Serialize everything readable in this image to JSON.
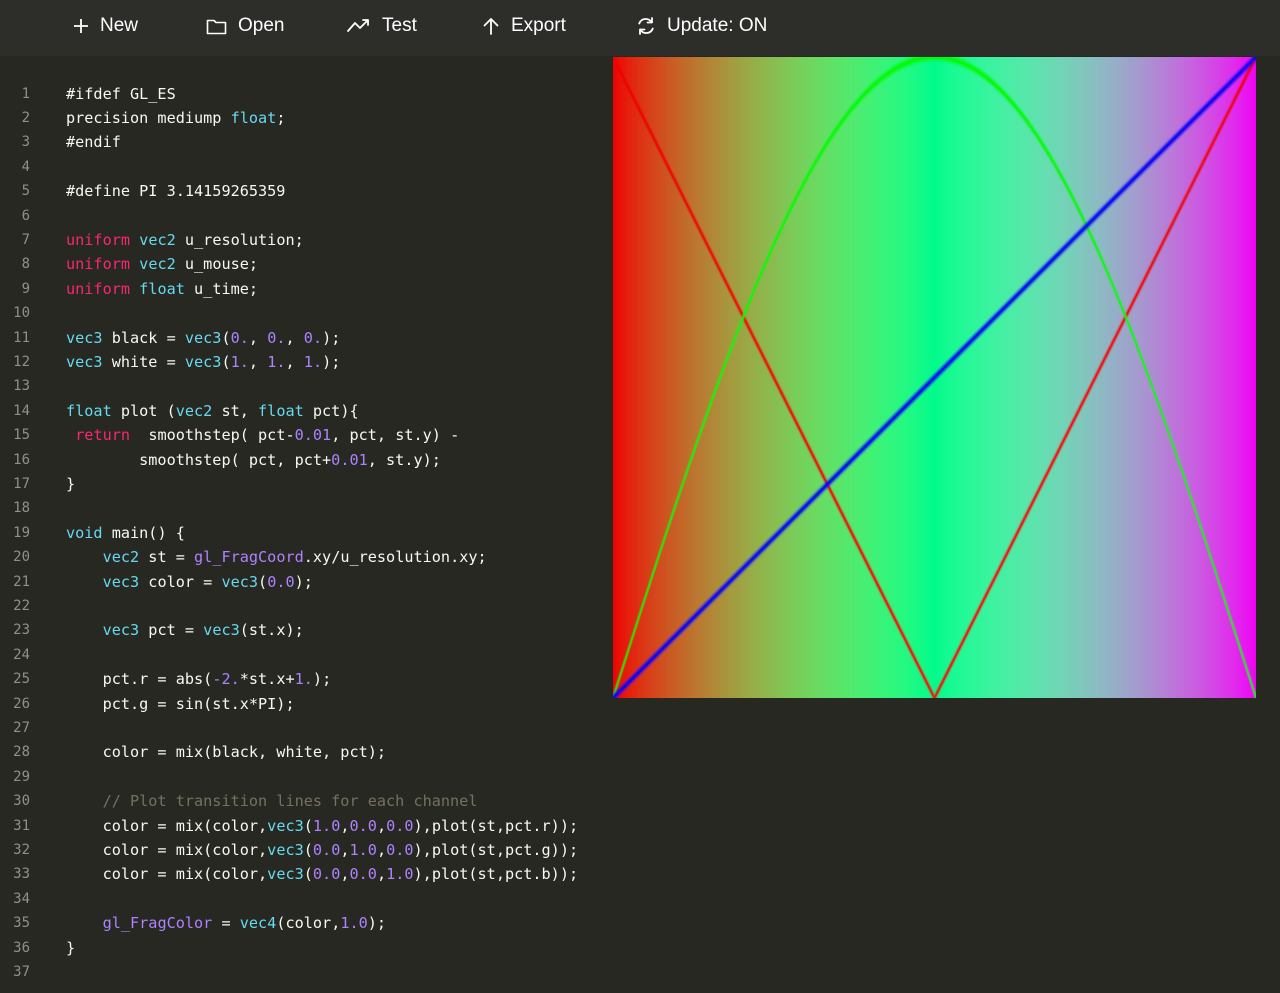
{
  "toolbar": {
    "new_label": "New",
    "open_label": "Open",
    "test_label": "Test",
    "export_label": "Export",
    "update_label": "Update: ON"
  },
  "colors": {
    "background": "#272822",
    "toolbar": "#2d2e2a",
    "keyword": "#f92672",
    "type": "#66d9ef",
    "number": "#ae81ff",
    "comment": "#75715e",
    "text": "#f8f8f2"
  },
  "code": [
    [
      [
        "",
        "#ifdef GL_ES"
      ]
    ],
    [
      [
        "",
        "precision mediump "
      ],
      [
        "ty",
        "float"
      ],
      [
        "",
        ";"
      ]
    ],
    [
      [
        "",
        "#endif"
      ]
    ],
    [],
    [
      [
        "",
        "#define PI 3.14159265359"
      ]
    ],
    [],
    [
      [
        "kw",
        "uniform"
      ],
      [
        "",
        " "
      ],
      [
        "ty",
        "vec2"
      ],
      [
        "",
        " u_resolution;"
      ]
    ],
    [
      [
        "kw",
        "uniform"
      ],
      [
        "",
        " "
      ],
      [
        "ty",
        "vec2"
      ],
      [
        "",
        " u_mouse;"
      ]
    ],
    [
      [
        "kw",
        "uniform"
      ],
      [
        "",
        " "
      ],
      [
        "ty",
        "float"
      ],
      [
        "",
        " u_time;"
      ]
    ],
    [],
    [
      [
        "ty",
        "vec3"
      ],
      [
        "",
        " black = "
      ],
      [
        "ty",
        "vec3"
      ],
      [
        "",
        "("
      ],
      [
        "nm",
        "0."
      ],
      [
        "",
        ", "
      ],
      [
        "nm",
        "0."
      ],
      [
        "",
        ", "
      ],
      [
        "nm",
        "0."
      ],
      [
        "",
        ");"
      ]
    ],
    [
      [
        "ty",
        "vec3"
      ],
      [
        "",
        " white = "
      ],
      [
        "ty",
        "vec3"
      ],
      [
        "",
        "("
      ],
      [
        "nm",
        "1."
      ],
      [
        "",
        ", "
      ],
      [
        "nm",
        "1."
      ],
      [
        "",
        ", "
      ],
      [
        "nm",
        "1."
      ],
      [
        "",
        ");"
      ]
    ],
    [],
    [
      [
        "ty",
        "float"
      ],
      [
        "",
        " plot ("
      ],
      [
        "ty",
        "vec2"
      ],
      [
        "",
        " st, "
      ],
      [
        "ty",
        "float"
      ],
      [
        "",
        " pct){"
      ]
    ],
    [
      [
        "",
        " "
      ],
      [
        "kw",
        "return"
      ],
      [
        "",
        "  smoothstep( pct-"
      ],
      [
        "nm",
        "0.01"
      ],
      [
        "",
        ", pct, st.y) -"
      ]
    ],
    [
      [
        "",
        "        smoothstep( pct, pct+"
      ],
      [
        "nm",
        "0.01"
      ],
      [
        "",
        ", st.y);"
      ]
    ],
    [
      [
        "",
        "}"
      ]
    ],
    [],
    [
      [
        "ty",
        "void"
      ],
      [
        "",
        " main() {"
      ]
    ],
    [
      [
        "",
        "    "
      ],
      [
        "ty",
        "vec2"
      ],
      [
        "",
        " st = "
      ],
      [
        "bi",
        "gl_FragCoord"
      ],
      [
        "",
        ".xy/u_resolution.xy;"
      ]
    ],
    [
      [
        "",
        "    "
      ],
      [
        "ty",
        "vec3"
      ],
      [
        "",
        " color = "
      ],
      [
        "ty",
        "vec3"
      ],
      [
        "",
        "("
      ],
      [
        "nm",
        "0.0"
      ],
      [
        "",
        ");"
      ]
    ],
    [],
    [
      [
        "",
        "    "
      ],
      [
        "ty",
        "vec3"
      ],
      [
        "",
        " pct = "
      ],
      [
        "ty",
        "vec3"
      ],
      [
        "",
        "(st.x);"
      ]
    ],
    [],
    [
      [
        "",
        "    pct.r = abs("
      ],
      [
        "nm",
        "-2."
      ],
      [
        "",
        "*st.x+"
      ],
      [
        "nm",
        "1."
      ],
      [
        "",
        ");"
      ]
    ],
    [
      [
        "",
        "    pct.g = sin(st.x*PI);"
      ]
    ],
    [],
    [
      [
        "",
        "    color = mix(black, white, pct);"
      ]
    ],
    [],
    [
      [
        "cm",
        "    // Plot transition lines for each channel"
      ]
    ],
    [
      [
        "",
        "    color = mix(color,"
      ],
      [
        "ty",
        "vec3"
      ],
      [
        "",
        "("
      ],
      [
        "nm",
        "1.0"
      ],
      [
        "",
        ","
      ],
      [
        "nm",
        "0.0"
      ],
      [
        "",
        ","
      ],
      [
        "nm",
        "0.0"
      ],
      [
        "",
        "),plot(st,pct.r));"
      ]
    ],
    [
      [
        "",
        "    color = mix(color,"
      ],
      [
        "ty",
        "vec3"
      ],
      [
        "",
        "("
      ],
      [
        "nm",
        "0.0"
      ],
      [
        "",
        ","
      ],
      [
        "nm",
        "1.0"
      ],
      [
        "",
        ","
      ],
      [
        "nm",
        "0.0"
      ],
      [
        "",
        "),plot(st,pct.g));"
      ]
    ],
    [
      [
        "",
        "    color = mix(color,"
      ],
      [
        "ty",
        "vec3"
      ],
      [
        "",
        "("
      ],
      [
        "nm",
        "0.0"
      ],
      [
        "",
        ","
      ],
      [
        "nm",
        "0.0"
      ],
      [
        "",
        ","
      ],
      [
        "nm",
        "1.0"
      ],
      [
        "",
        "),plot(st,pct.b));"
      ]
    ],
    [],
    [
      [
        "",
        "    "
      ],
      [
        "bi",
        "gl_FragColor"
      ],
      [
        "",
        " = "
      ],
      [
        "ty",
        "vec4"
      ],
      [
        "",
        "(color,"
      ],
      [
        "nm",
        "1.0"
      ],
      [
        "",
        ");"
      ]
    ],
    [
      [
        "",
        "}"
      ]
    ],
    []
  ]
}
